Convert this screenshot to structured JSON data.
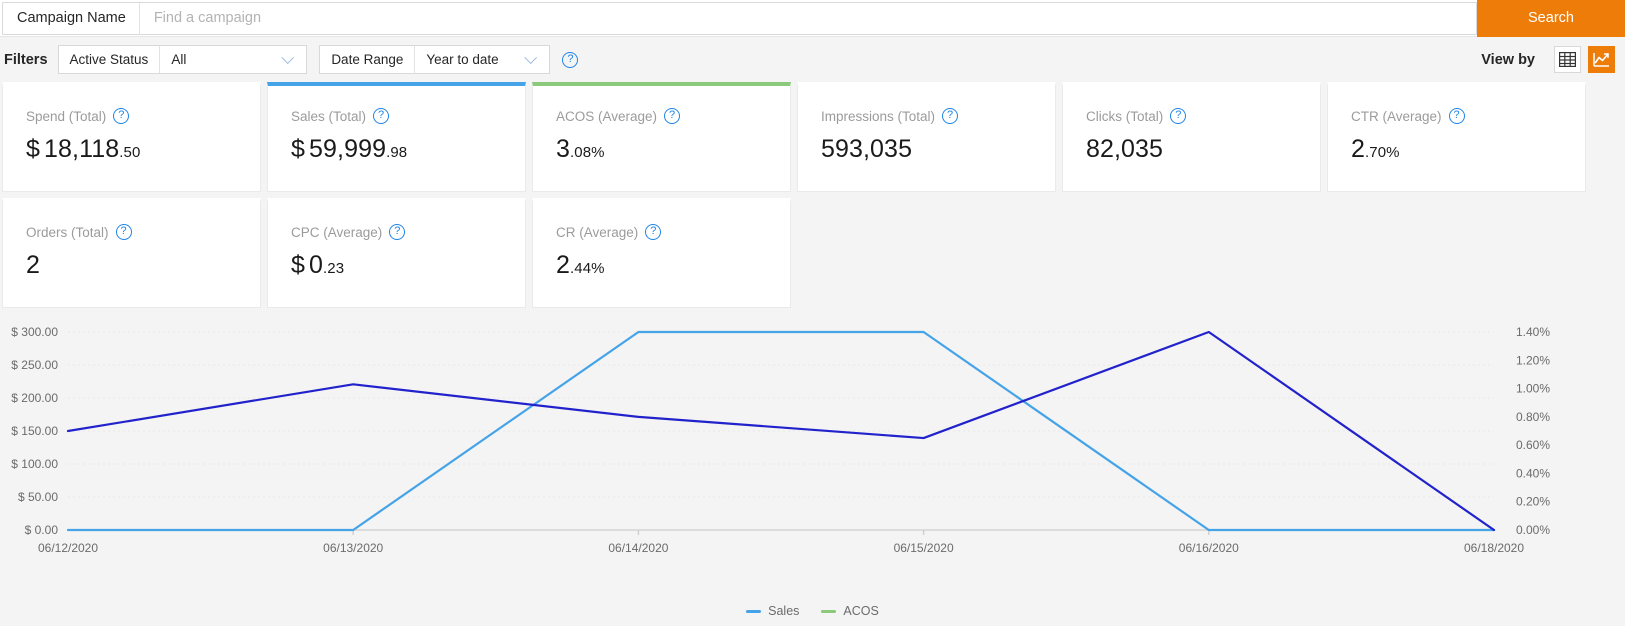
{
  "search": {
    "label": "Campaign Name",
    "placeholder": "Find a campaign",
    "value": "",
    "button_label": "Search"
  },
  "filters": {
    "label": "Filters",
    "items": [
      {
        "key": "Active Status",
        "value": "All",
        "options": [
          "All"
        ]
      },
      {
        "key": "Date Range",
        "value": "Year to date",
        "options": [
          "Year to date"
        ]
      }
    ],
    "help_glyph": "?"
  },
  "view_by": {
    "label": "View by",
    "options": [
      {
        "name": "table",
        "active": false
      },
      {
        "name": "chart",
        "active": true
      }
    ]
  },
  "cards": [
    {
      "title": "Spend (Total)",
      "currency": "$",
      "main": "18,118",
      "decimal": ".50",
      "suffix": "",
      "accent": "transparent"
    },
    {
      "title": "Sales (Total)",
      "currency": "$",
      "main": "59,999",
      "decimal": ".98",
      "suffix": "",
      "accent": "#45a3e8"
    },
    {
      "title": "ACOS (Average)",
      "currency": "",
      "main": "3",
      "decimal": ".08",
      "suffix": "%",
      "accent": "#8bc97b"
    },
    {
      "title": "Impressions (Total)",
      "currency": "",
      "main": "593,035",
      "decimal": "",
      "suffix": "",
      "accent": "transparent"
    },
    {
      "title": "Clicks (Total)",
      "currency": "",
      "main": "82,035",
      "decimal": "",
      "suffix": "",
      "accent": "transparent"
    },
    {
      "title": "CTR (Average)",
      "currency": "",
      "main": "2",
      "decimal": ".70",
      "suffix": "%",
      "accent": "transparent"
    },
    {
      "title": "Orders (Total)",
      "currency": "",
      "main": "2",
      "decimal": "",
      "suffix": "",
      "accent": "transparent"
    },
    {
      "title": "CPC (Average)",
      "currency": "$",
      "main": "0",
      "decimal": ".23",
      "suffix": "",
      "accent": "transparent"
    },
    {
      "title": "CR (Average)",
      "currency": "",
      "main": "2",
      "decimal": ".44",
      "suffix": "%",
      "accent": "transparent"
    }
  ],
  "chart_data": {
    "type": "line",
    "title": "",
    "xlabel": "",
    "grid": true,
    "legend_position": "bottom-center",
    "x": [
      "06/12/2020",
      "06/13/2020",
      "06/14/2020",
      "06/15/2020",
      "06/16/2020",
      "06/18/2020"
    ],
    "y_left": {
      "label": "",
      "ticks": [
        "$ 0.00",
        "$ 50.00",
        "$ 100.00",
        "$ 150.00",
        "$ 200.00",
        "$ 250.00",
        "$ 300.00"
      ],
      "tick_values": [
        0,
        50,
        100,
        150,
        200,
        250,
        300
      ],
      "ylim": [
        0,
        300
      ]
    },
    "y_right": {
      "label": "",
      "ticks": [
        "0.00%",
        "0.20%",
        "0.40%",
        "0.60%",
        "0.80%",
        "1.00%",
        "1.20%",
        "1.40%"
      ],
      "tick_values": [
        0,
        0.2,
        0.4,
        0.6,
        0.8,
        1.0,
        1.2,
        1.4
      ],
      "ylim": [
        0,
        1.4
      ]
    },
    "series": [
      {
        "name": "Sales",
        "color": "#45a3e8",
        "axis": "left",
        "unit": "$",
        "values": [
          0,
          0,
          300,
          300,
          0,
          0
        ]
      },
      {
        "name": "ACOS",
        "color": "#2222cc",
        "axis": "right",
        "unit": "%",
        "values": [
          0.7,
          1.03,
          0.8,
          0.65,
          1.4,
          0.0
        ]
      }
    ],
    "legend": [
      {
        "label": "Sales",
        "color": "#45a3e8"
      },
      {
        "label": "ACOS",
        "color": "#8bc97b"
      }
    ]
  }
}
